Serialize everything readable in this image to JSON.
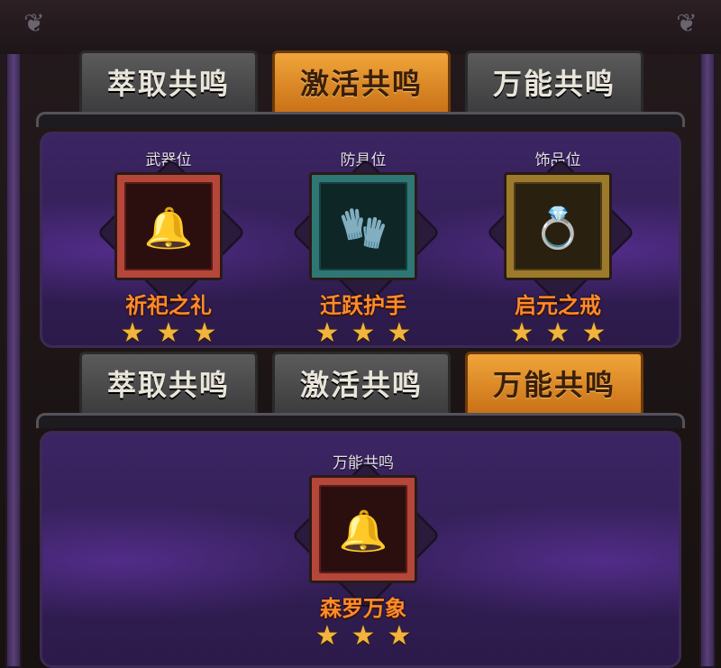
{
  "tabs_top": [
    {
      "label": "萃取共鸣",
      "active": false
    },
    {
      "label": "激活共鸣",
      "active": true
    },
    {
      "label": "万能共鸣",
      "active": false
    }
  ],
  "slots_top": [
    {
      "slot_label": "武器位",
      "item_name": "祈祀之礼",
      "stars": 3,
      "frame": "red",
      "icon": "bell-charm-icon"
    },
    {
      "slot_label": "防具位",
      "item_name": "迁跃护手",
      "stars": 3,
      "frame": "teal",
      "icon": "gauntlet-icon"
    },
    {
      "slot_label": "饰品位",
      "item_name": "启元之戒",
      "stars": 3,
      "frame": "gold",
      "icon": "ring-icon"
    }
  ],
  "tabs_bottom": [
    {
      "label": "萃取共鸣",
      "active": false
    },
    {
      "label": "激活共鸣",
      "active": false
    },
    {
      "label": "万能共鸣",
      "active": true
    }
  ],
  "slot_bottom": {
    "slot_label": "万能共鸣",
    "item_name": "森罗万象",
    "stars": 3,
    "frame": "red",
    "icon": "bell-icon"
  },
  "colors": {
    "accent": "#f0a53a",
    "item_name": "#ff8a2a",
    "arena": "#3b2563",
    "star": "#f2b43c"
  }
}
